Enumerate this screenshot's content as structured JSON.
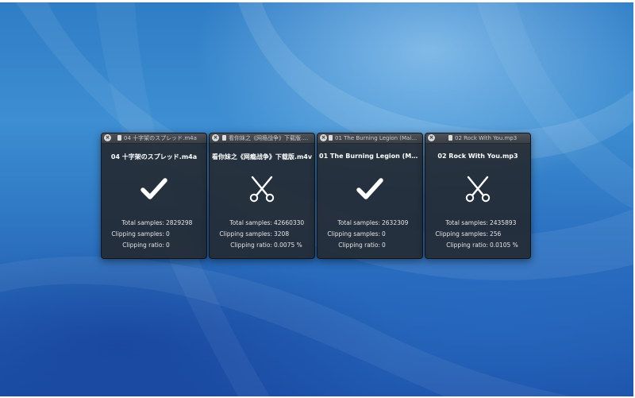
{
  "panels": [
    {
      "window_title": "04 十字架のスプレッド.m4a",
      "file_name": "04 十字架のスプレッド.m4a",
      "status_icon": "checkmark-icon",
      "stats": {
        "total_label": "Total samples:",
        "total_value": "2829298",
        "clipping_label": "Clipping samples:",
        "clipping_value": "0",
        "ratio_label": "Clipping ratio:",
        "ratio_value": "0"
      }
    },
    {
      "window_title": "看你妹之《网瘾战争》下载版.m4v",
      "file_name": "看你妹之《网瘾战争》下载版.m4v",
      "status_icon": "scissors-icon",
      "stats": {
        "total_label": "Total samples:",
        "total_value": "42660330",
        "clipping_label": "Clipping samples:",
        "clipping_value": "3208",
        "ratio_label": "Clipping ratio:",
        "ratio_value": "0.0075 %"
      }
    },
    {
      "window_title": "01 The Burning Legion (Main Title...",
      "file_name": "01 The Burning Legion (Ma...",
      "status_icon": "checkmark-icon",
      "stats": {
        "total_label": "Total samples:",
        "total_value": "2632309",
        "clipping_label": "Clipping samples:",
        "clipping_value": "0",
        "ratio_label": "Clipping ratio:",
        "ratio_value": "0"
      }
    },
    {
      "window_title": "02 Rock With You.mp3",
      "file_name": "02 Rock With You.mp3",
      "status_icon": "scissors-icon",
      "stats": {
        "total_label": "Total samples:",
        "total_value": "2435893",
        "clipping_label": "Clipping samples:",
        "clipping_value": "256",
        "ratio_label": "Clipping ratio:",
        "ratio_value": "0.0105 %"
      }
    }
  ],
  "colors": {
    "panel_bg": "#24282f",
    "text": "#e4e4e4",
    "desktop_blue": "#2c72c0"
  }
}
